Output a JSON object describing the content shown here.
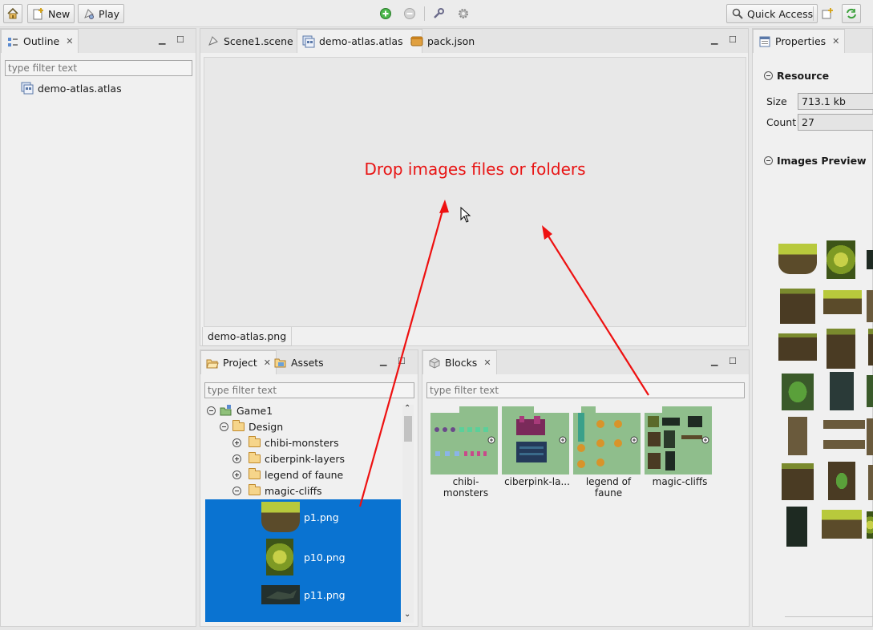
{
  "toolbar": {
    "new_label": "New",
    "play_label": "Play",
    "quick_access_label": "Quick Access"
  },
  "outline": {
    "tab_label": "Outline",
    "filter_placeholder": "type filter text",
    "items": [
      {
        "label": "demo-atlas.atlas"
      }
    ]
  },
  "editor": {
    "tabs": [
      {
        "label": "Scene1.scene"
      },
      {
        "label": "demo-atlas.atlas"
      },
      {
        "label": "pack.json"
      }
    ],
    "drop_message": "Drop images files or folders",
    "bottom_tab": "demo-atlas.png"
  },
  "project": {
    "tabs": [
      {
        "label": "Project"
      },
      {
        "label": "Assets"
      }
    ],
    "filter_placeholder": "type filter text",
    "tree": [
      {
        "label": "Game1"
      },
      {
        "label": "Design"
      },
      {
        "label": "chibi-monsters"
      },
      {
        "label": "ciberpink-layers"
      },
      {
        "label": "legend of faune"
      },
      {
        "label": "magic-cliffs"
      }
    ],
    "files": [
      {
        "label": "p1.png"
      },
      {
        "label": "p10.png"
      },
      {
        "label": "p11.png"
      }
    ]
  },
  "blocks": {
    "tab_label": "Blocks",
    "filter_placeholder": "type filter text",
    "items": [
      {
        "label": "chibi-monsters"
      },
      {
        "label": "ciberpink-la..."
      },
      {
        "label": "legend of faune"
      },
      {
        "label": "magic-cliffs"
      }
    ]
  },
  "properties": {
    "tab_label": "Properties",
    "resource_section": "Resource",
    "size_label": "Size",
    "size_value": "713.1 kb",
    "count_label": "Count",
    "count_value": "27",
    "images_section": "Images Preview"
  },
  "colors": {
    "annotation": "#ee1111",
    "selection": "#0a73d1",
    "thumb_bg": "#8fbe8c"
  }
}
